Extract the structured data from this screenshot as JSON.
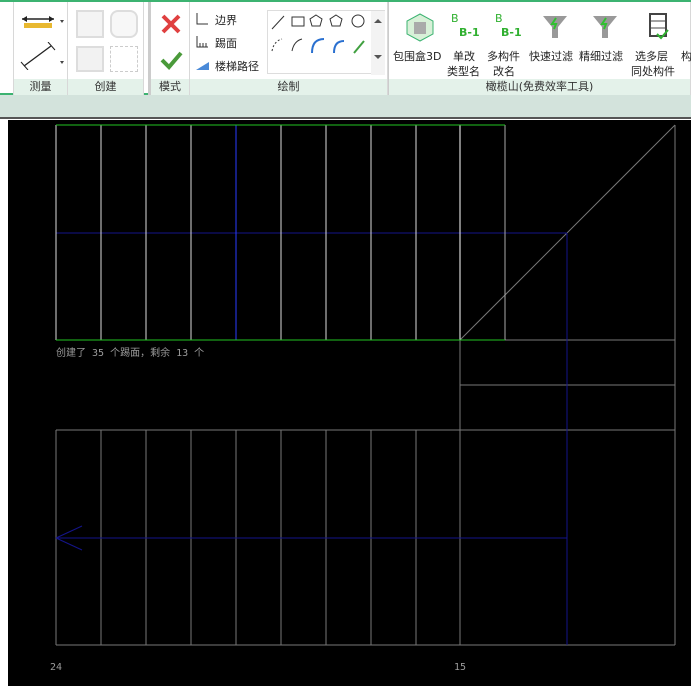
{
  "ribbon": {
    "panels": {
      "measure": "测量",
      "create": "创建",
      "mode": "模式",
      "draw": "绘制",
      "ganlanshan": "橄榄山(免费效率工具)"
    },
    "draw_tools": {
      "boundary": "边界",
      "riser": "踢面",
      "stair_path": "楼梯路径"
    },
    "ganlanshan_tools": [
      {
        "label": "包围盒3D"
      },
      {
        "label": "单改",
        "label2": "类型名"
      },
      {
        "label": "多构件",
        "label2": "改名"
      },
      {
        "label": "快速过滤"
      },
      {
        "label": "精细过滤"
      },
      {
        "label": "选多层",
        "label2": "同处构件"
      },
      {
        "label": "构"
      }
    ],
    "icon_text": {
      "b": "B",
      "b1": "B-1"
    }
  },
  "canvas": {
    "status_text": "创建了 35 个踢面，剩余 13 个",
    "label_left": "24",
    "label_right": "15"
  },
  "colors": {
    "green_boundary": "#22c322",
    "blue_path": "#2a3cff",
    "accent": "#3cb371"
  }
}
